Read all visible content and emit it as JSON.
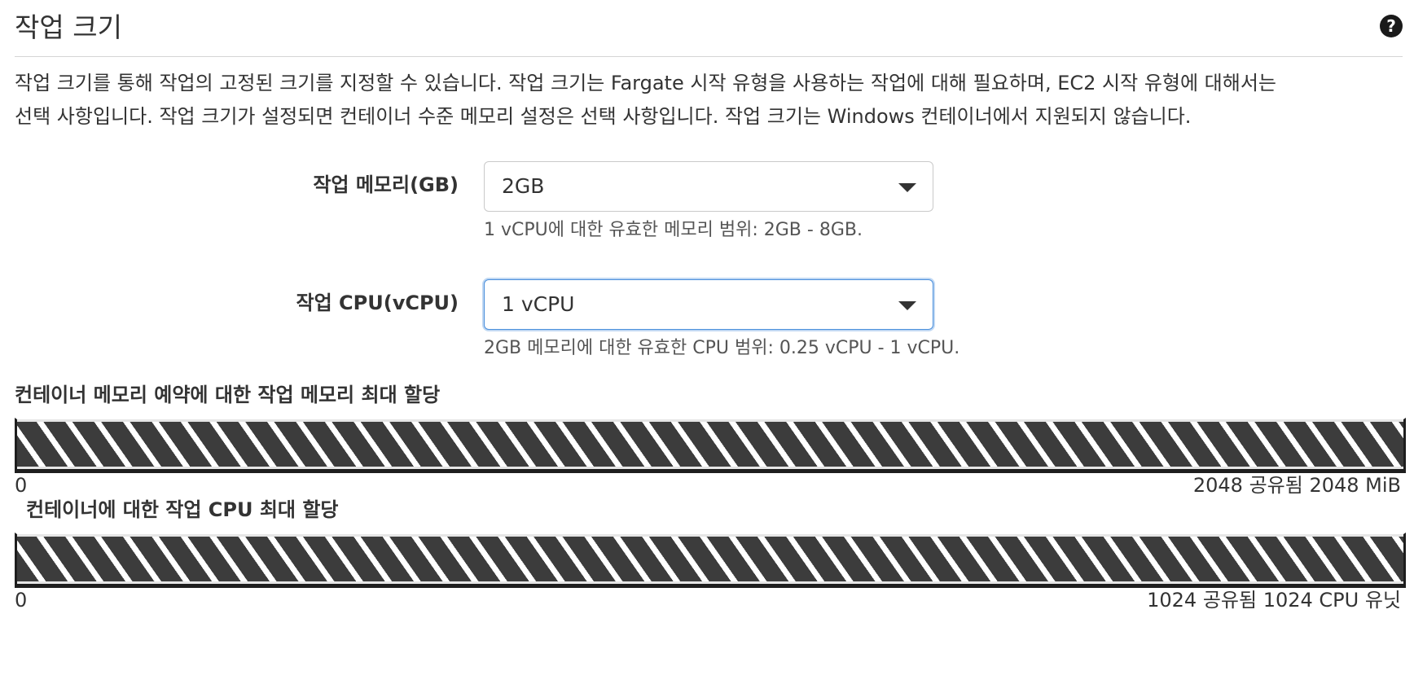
{
  "section": {
    "title": "작업 크기",
    "help_icon": "?",
    "description_line1": "작업 크기를 통해 작업의 고정된 크기를 지정할 수 있습니다. 작업 크기는 Fargate 시작 유형을 사용하는 작업에 대해 필요하며, EC2 시작 유형에 대해서는",
    "description_line2": "선택 사항입니다. 작업 크기가 설정되면 컨테이너 수준 메모리 설정은 선택 사항입니다. 작업 크기는 Windows 컨테이너에서 지원되지 않습니다."
  },
  "memory_field": {
    "label": "작업 메모리(GB)",
    "value": "2GB",
    "help": "1 vCPU에 대한 유효한 메모리 범위: 2GB - 8GB."
  },
  "cpu_field": {
    "label": "작업 CPU(vCPU)",
    "value": "1 vCPU",
    "help": "2GB 메모리에 대한 유효한 CPU 범위: 0.25 vCPU - 1 vCPU."
  },
  "memory_allocation": {
    "title": "컨테이너 메모리 예약에 대한 작업 메모리 최대 할당",
    "min_label": "0",
    "max_label": "2048 공유됨 2048 MiB",
    "fill_fraction": 1.0
  },
  "cpu_allocation": {
    "title": "컨테이너에 대한 작업 CPU 최대 할당",
    "min_label": "0",
    "max_label": "1024 공유됨 1024 CPU 유닛",
    "fill_fraction": 1.0
  },
  "colors": {
    "focus_border": "#4a8fdc",
    "bar_stripe_dark": "#3c3c3c",
    "bar_stripe_light": "#ffffff"
  }
}
